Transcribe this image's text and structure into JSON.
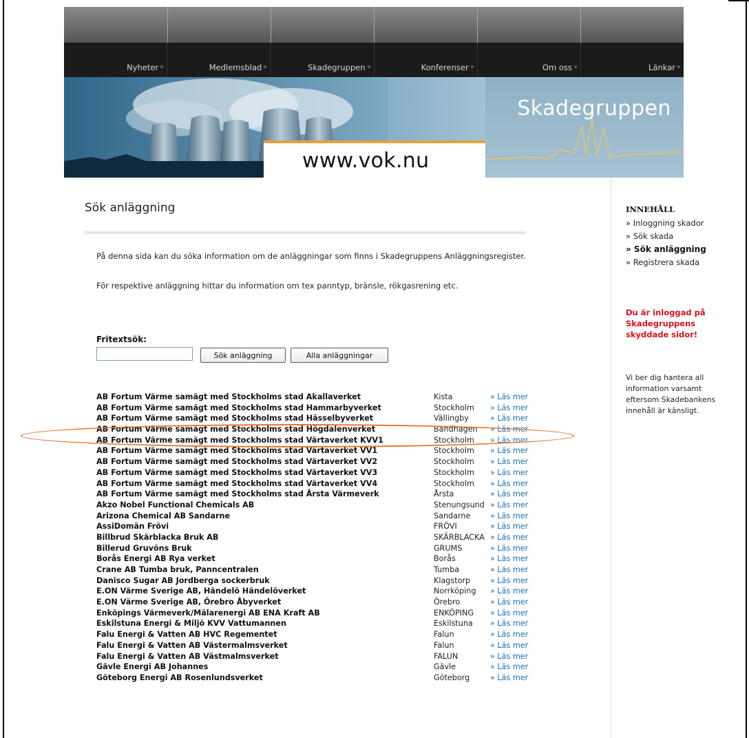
{
  "nav": {
    "items": [
      "Nyheter",
      "Medlemsblad",
      "Skadegruppen",
      "Konferenser",
      "Om oss",
      "Länkar"
    ]
  },
  "banner": {
    "title": "Skadegruppen",
    "url": "www.vok.nu"
  },
  "page": {
    "title": "Sök anläggning",
    "intro1": "På denna sida kan du söka information om de anläggningar som finns i Skadegruppens Anläggningsregister.",
    "intro2": "För respektive anläggning hittar du information om tex panntyp, bränsle, rökgasrening etc."
  },
  "search": {
    "label": "Fritextsök:",
    "input_value": "",
    "search_button": "Sök anläggning",
    "all_button": "Alla anläggningar"
  },
  "list": {
    "more_label": "» Läs mer",
    "rows": [
      {
        "name": "AB Fortum Värme samägt med Stockholms stad Akallaverket",
        "city": "Kista"
      },
      {
        "name": "AB Fortum Värme samägt med Stockholms stad Hammarbyverket",
        "city": "Stockholm"
      },
      {
        "name": "AB Fortum Värme samägt med Stockholms stad Hässelbyverket",
        "city": "Vällingby"
      },
      {
        "name": "AB Fortum Värme samägt med Stockholms stad Högdalenverket",
        "city": "Bandhagen"
      },
      {
        "name": "AB Fortum Värme samägt med Stockholms stad Värtaverket KVV1",
        "city": "Stockholm"
      },
      {
        "name": "AB Fortum Värme samägt med Stockholms stad Värtaverket VV1",
        "city": "Stockholm"
      },
      {
        "name": "AB Fortum Värme samägt med Stockholms stad Värtaverket VV2",
        "city": "Stockholm"
      },
      {
        "name": "AB Fortum Värme samägt med Stockholms stad Värtaverket VV3",
        "city": "Stockholm"
      },
      {
        "name": "AB Fortum Värme samägt med Stockholms stad Värtaverket VV4",
        "city": "Stockholm"
      },
      {
        "name": "AB Fortum Värme samägt med Stockholms stad Årsta Värmeverk",
        "city": "Årsta"
      },
      {
        "name": "Akzo Nobel Functional Chemicals AB",
        "city": "Stenungsund"
      },
      {
        "name": "Arizona Chemical AB Sandarne",
        "city": "Sandarne"
      },
      {
        "name": "AssiDomän Frövi",
        "city": "FRÖVI"
      },
      {
        "name": "Billbrud Skärblacka Bruk AB",
        "city": "SKÄRBLACKA"
      },
      {
        "name": "Billerud Gruvöns Bruk",
        "city": "GRUMS"
      },
      {
        "name": "Borås Energi AB Rya verket",
        "city": "Borås"
      },
      {
        "name": "Crane AB Tumba bruk, Panncentralen",
        "city": "Tumba"
      },
      {
        "name": "Danisco Sugar AB Jordberga sockerbruk",
        "city": "Klagstorp"
      },
      {
        "name": "E.ON Värme Sverige AB, Händelö Händelöverket",
        "city": "Norrköping"
      },
      {
        "name": "E.ON Värme Sverige AB, Örebro Åbyverket",
        "city": "Örebro"
      },
      {
        "name": "Enköpings Värmeverk/Mälarenergi AB ENA Kraft AB",
        "city": "ENKÖPING"
      },
      {
        "name": "Eskilstuna Energi & Miljö KVV Vattumannen",
        "city": "Eskilstuna"
      },
      {
        "name": "Falu Energi & Vatten AB HVC Regementet",
        "city": "Falun"
      },
      {
        "name": "Falu Energi & Vatten AB Västermalmsverket",
        "city": "Falun"
      },
      {
        "name": "Falu Energi & Vatten AB Västmalmsverket",
        "city": "FALUN"
      },
      {
        "name": "Gävle Energi AB Johannes",
        "city": "Gävle"
      },
      {
        "name": "Göteborg Energi AB Rosenlundsverket",
        "city": "Göteborg"
      }
    ]
  },
  "sidebar": {
    "heading": "INNEHÅLL",
    "links": [
      "» Inloggning skador",
      "» Sök skada",
      "» Sök anläggning",
      "» Registrera skada"
    ],
    "alert": "Du är inloggad på Skadegruppens skyddade sidor!",
    "note": "Vi ber dig hantera all information varsamt eftersom Skadebankens innehåll är känsligt."
  },
  "colors": {
    "nav_bg": "#1b1b1b",
    "link": "#1a6fb5",
    "alert": "#d6141b",
    "highlight_ring": "#e8732a",
    "banner_accent": "#e8a13a"
  }
}
